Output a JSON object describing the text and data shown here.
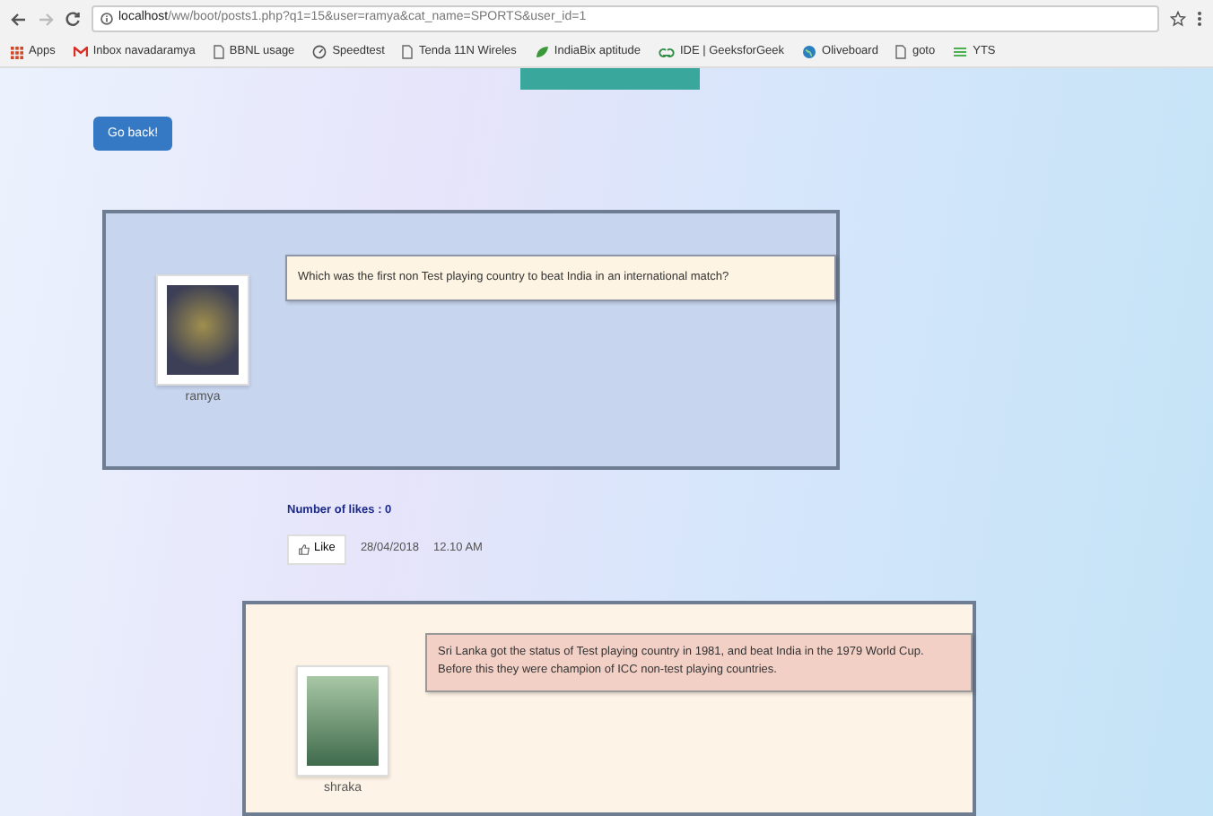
{
  "browser": {
    "url_host": "localhost",
    "url_path": "/ww/boot/posts1.php?q1=15&user=ramya&cat_name=SPORTS&user_id=1",
    "bookmarks": [
      {
        "label": "Apps",
        "kind": "apps"
      },
      {
        "label": "Inbox navadaramya",
        "kind": "mail"
      },
      {
        "label": "BBNL usage",
        "kind": "page"
      },
      {
        "label": "Speedtest",
        "kind": "gauge"
      },
      {
        "label": "Tenda 11N Wireles",
        "kind": "page"
      },
      {
        "label": "IndiaBix aptitude",
        "kind": "leaf"
      },
      {
        "label": "IDE | GeeksforGeek",
        "kind": "gfg"
      },
      {
        "label": "Oliveboard",
        "kind": "globe"
      },
      {
        "label": "goto",
        "kind": "page"
      },
      {
        "label": "YTS",
        "kind": "yts"
      }
    ]
  },
  "page": {
    "back_button": "Go back!",
    "question": {
      "user": "ramya",
      "text": "Which was the first non Test playing country to beat India in an international match?"
    },
    "likes": {
      "label": "Number of likes : 0",
      "button": "Like",
      "date": "28/04/2018",
      "time": "12.10 AM"
    },
    "answer": {
      "user": "shraka",
      "text": "Sri Lanka got the status of Test playing country in 1981, and beat India in the 1979 World Cup. Before this they were champion of ICC non-test playing countries."
    }
  }
}
